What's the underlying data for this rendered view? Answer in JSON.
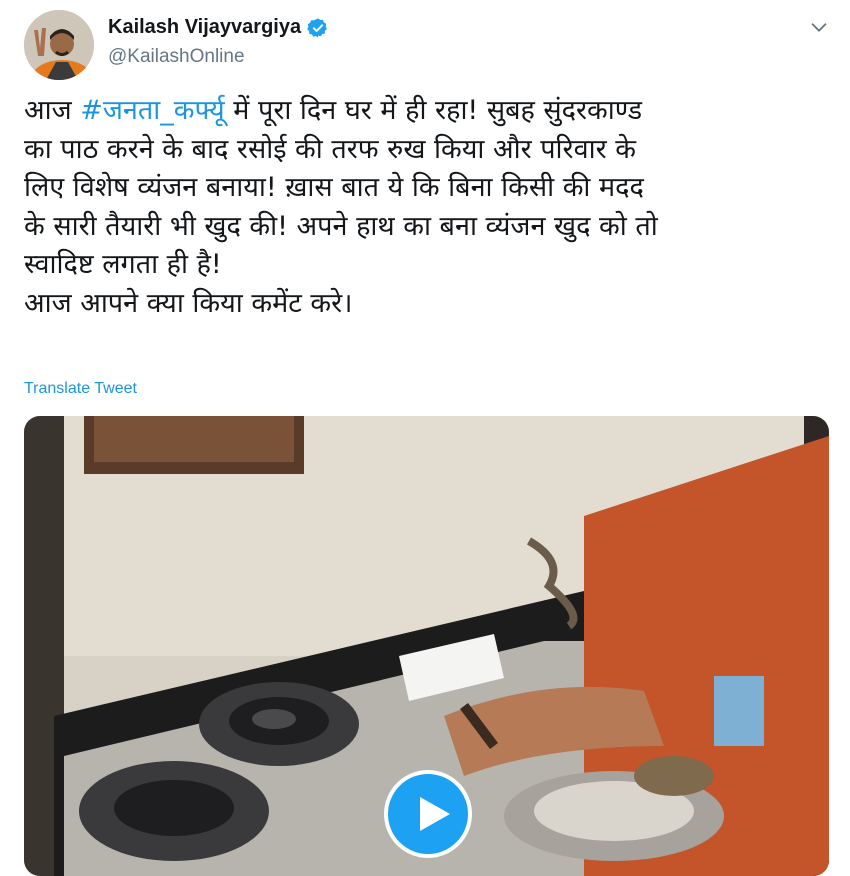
{
  "author": {
    "display_name": "Kailash Vijayvargiya",
    "handle": "@KailashOnline",
    "verified": true,
    "avatar_icon": "profile-avatar",
    "verified_icon": "verified-badge-icon"
  },
  "menu_icon": "chevron-down-icon",
  "tweet": {
    "lines": [
      {
        "before": "आज ",
        "hashtag": "#जनता_कर्फ्यू",
        "after": " में पूरा दिन घर में ही रहा! सुबह सुंदरकाण्ड"
      },
      {
        "text": "का पाठ करने के बाद रसोई की तरफ रुख किया और परिवार के"
      },
      {
        "text": "लिए विशेष व्यंजन बनाया! ख़ास बात ये कि बिना किसी की मदद"
      },
      {
        "text": "के सारी तैयारी भी खुद की! अपने हाथ का बना व्यंजन खुद को तो"
      },
      {
        "text": "स्वादिष्ट लगता ही है!"
      },
      {
        "text": "आज आपने क्या किया कमेंट करे।"
      }
    ]
  },
  "translate_label": "Translate Tweet",
  "media": {
    "type": "video",
    "play_icon": "play-icon",
    "accent_color": "#1da1f2"
  },
  "colors": {
    "link": "#1b95e0",
    "secondary_text": "#657786",
    "verified": "#1da1f2"
  }
}
